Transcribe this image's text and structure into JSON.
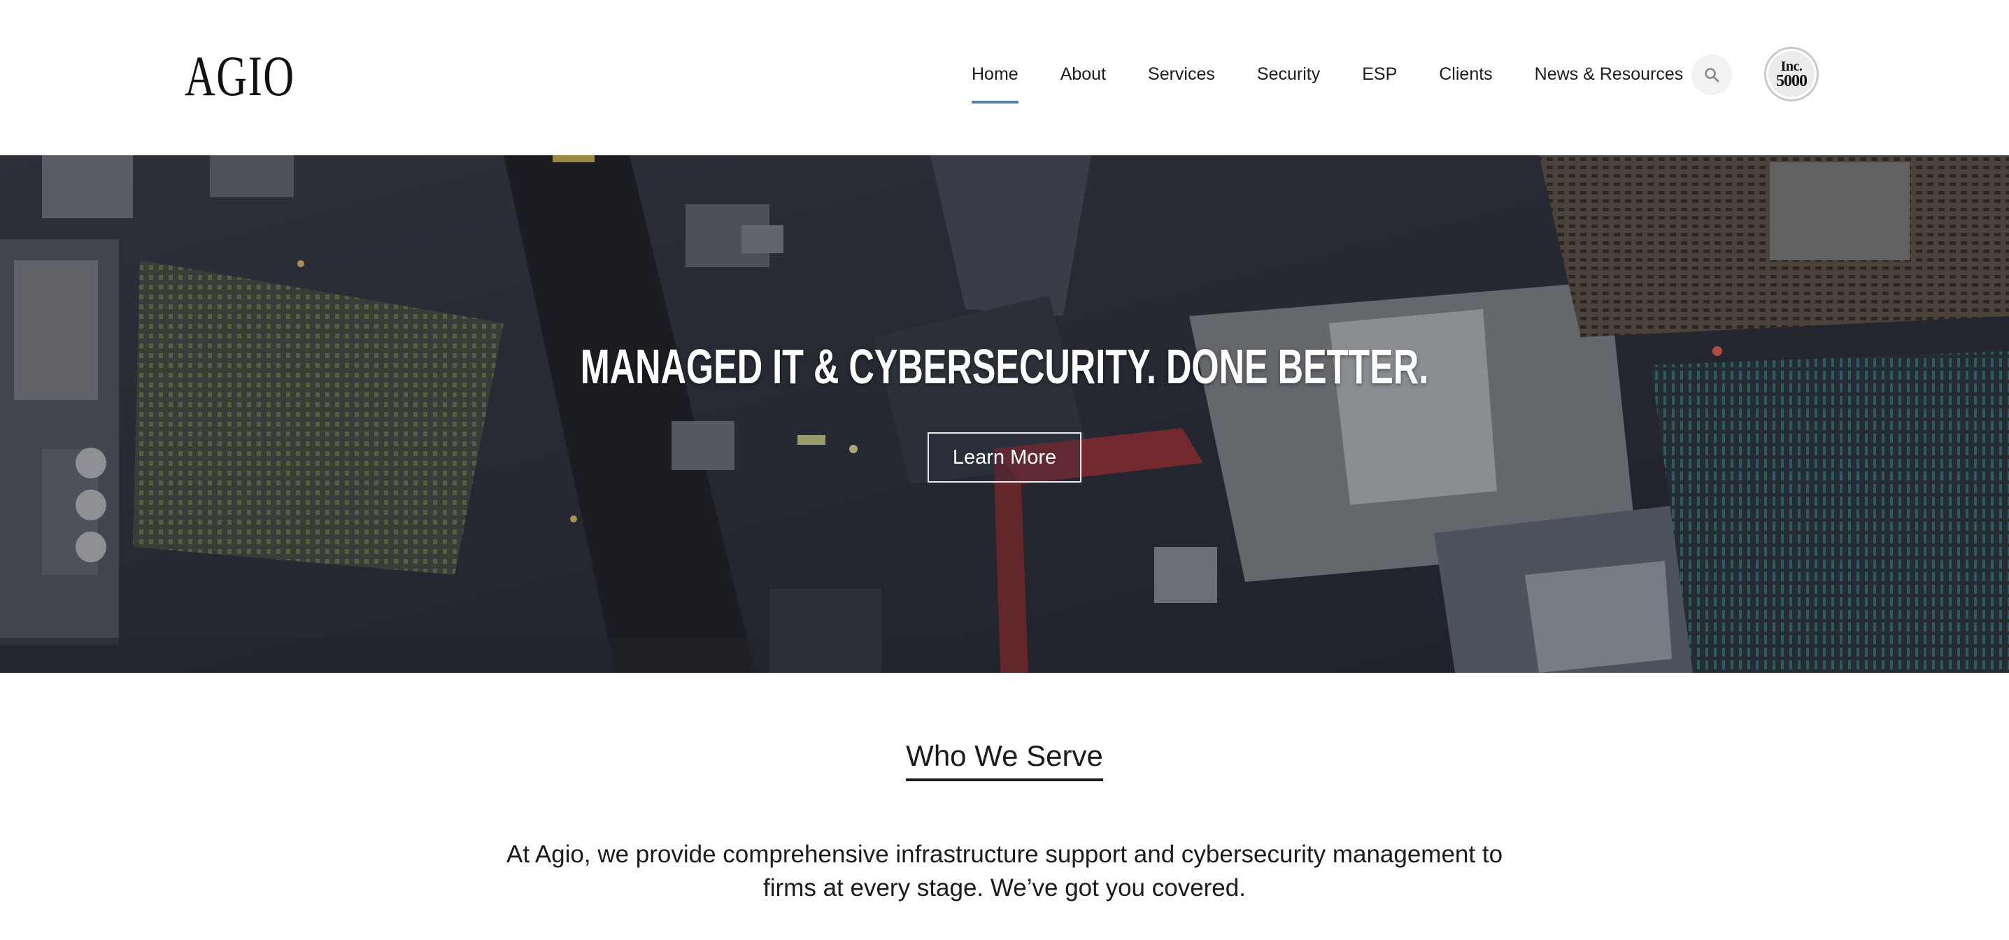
{
  "header": {
    "logo_text": "AGIO",
    "nav": [
      {
        "label": "Home",
        "active": true
      },
      {
        "label": "About",
        "active": false
      },
      {
        "label": "Services",
        "active": false
      },
      {
        "label": "Security",
        "active": false
      },
      {
        "label": "ESP",
        "active": false
      },
      {
        "label": "Clients",
        "active": false
      },
      {
        "label": "News & Resources",
        "active": false
      }
    ],
    "search_icon": "search-icon",
    "badge": {
      "line1": "Inc.",
      "line2": "5000"
    }
  },
  "hero": {
    "title": "MANAGED IT & CYBERSECURITY.  DONE BETTER.",
    "button_label": "Learn More",
    "background": "aerial-city-photo"
  },
  "who_we_serve": {
    "heading": "Who We Serve",
    "body": "At Agio, we provide comprehensive infrastructure support and cybersecurity management to firms at every stage. We’ve got you covered."
  },
  "colors": {
    "active_nav_underline": "#5b7fa6",
    "text": "#1b1b1b",
    "search_bg": "#f2f2f2"
  }
}
